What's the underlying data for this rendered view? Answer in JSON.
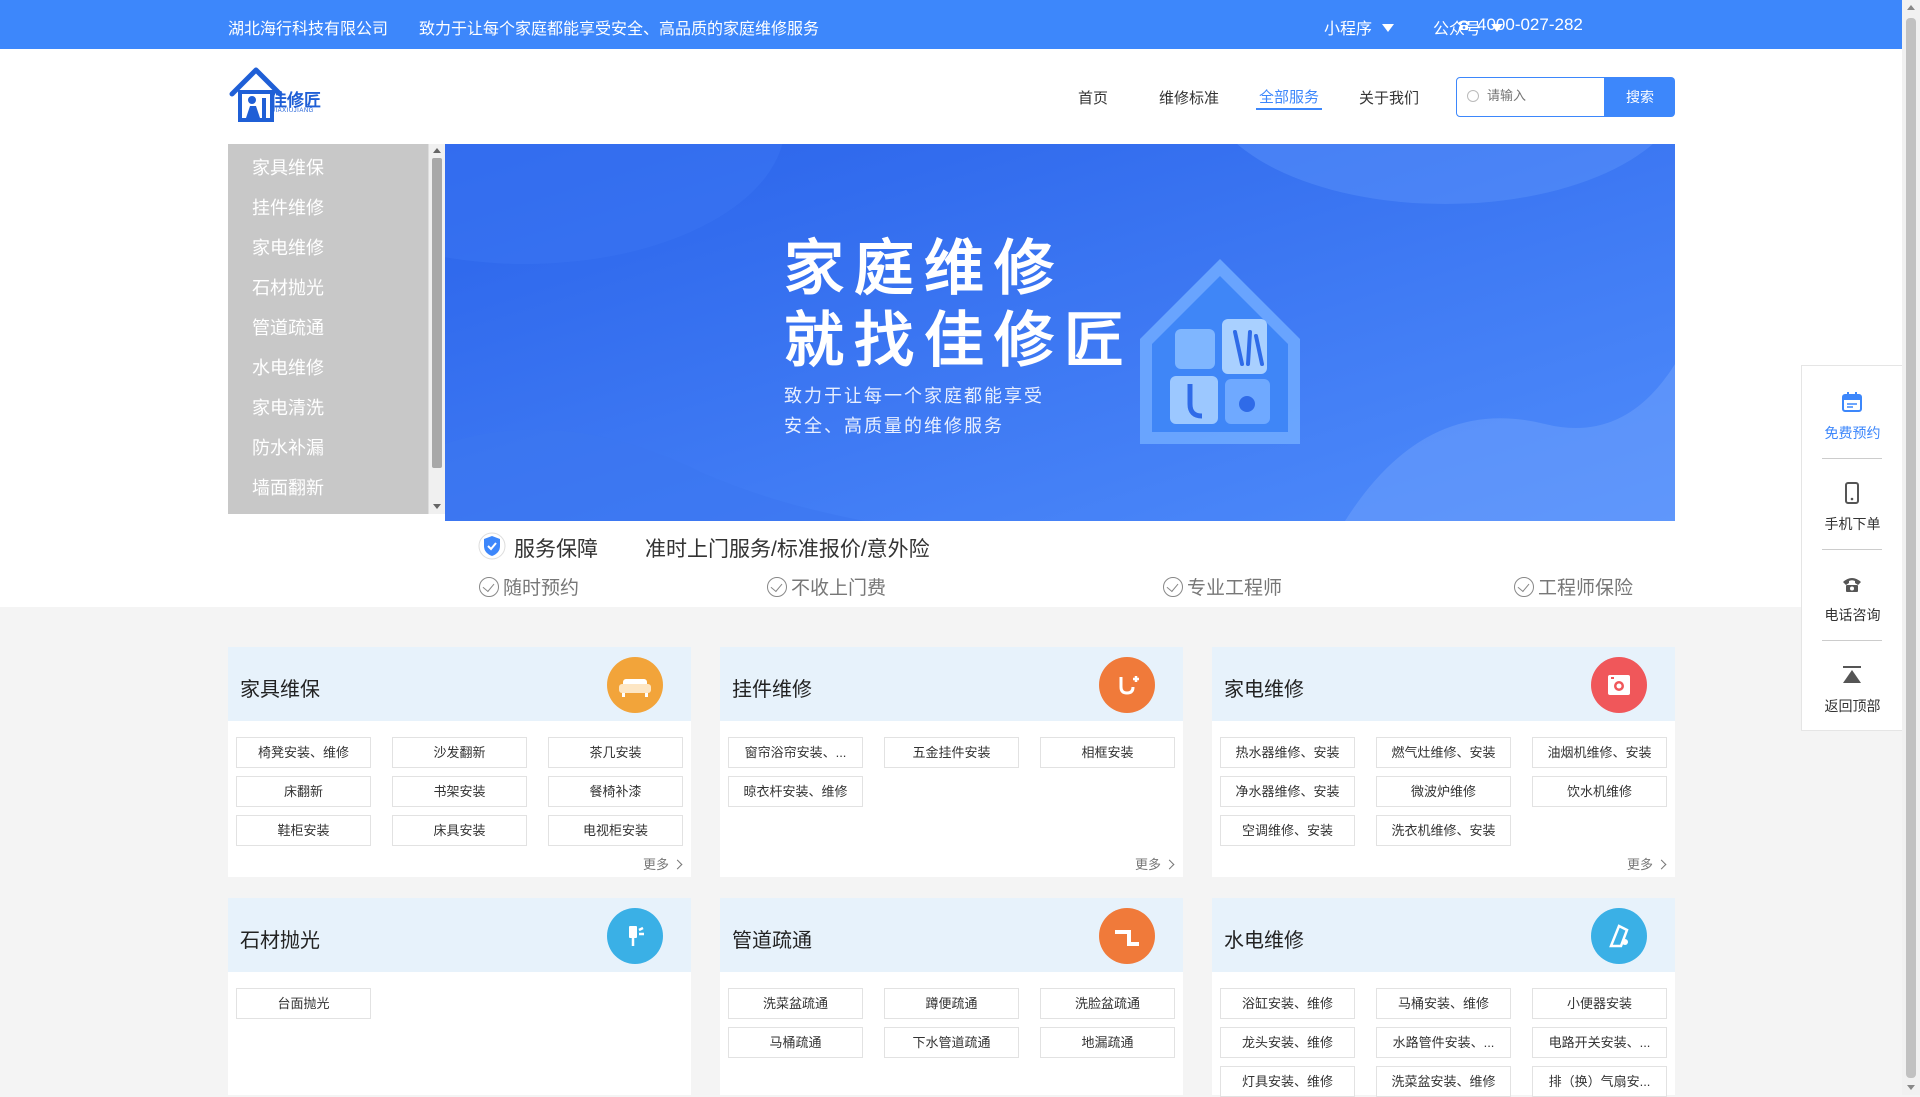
{
  "topbar": {
    "company": "湖北海行科技有限公司",
    "slogan": "致力于让每个家庭都能享受安全、高品质的家庭维修服务",
    "miniprogram": "小程序",
    "official_account": "公众号",
    "phone": "4000-027-282"
  },
  "header": {
    "logo_text": "佳修匠",
    "logo_sub": "JIAXIUJIANG",
    "nav": [
      "首页",
      "维修标准",
      "全部服务",
      "关于我们"
    ],
    "active_nav": "全部服务",
    "search_placeholder": "请输入",
    "search_button": "搜索"
  },
  "category_menu": [
    "家具维保",
    "挂件维修",
    "家电维修",
    "石材抛光",
    "管道疏通",
    "水电维修",
    "家电清洗",
    "防水补漏",
    "墙面翻新"
  ],
  "banner": {
    "title_line1": "家庭维修",
    "title_line2": "就找佳修匠",
    "subtitle_line1": "致力于让每一个家庭都能享受",
    "subtitle_line2": "安全、高质量的维修服务"
  },
  "guarantee": {
    "title": "服务保障",
    "desc": "准时上门服务/标准报价/意外险",
    "features": [
      "随时预约",
      "不收上门费",
      "专业工程师",
      "工程师保险"
    ]
  },
  "cards": [
    {
      "name": "家具维保",
      "icon": "sofa-icon",
      "color": "#f2a43a",
      "tags": [
        "椅凳安装、维修",
        "沙发翻新",
        "茶几安装",
        "床翻新",
        "书架安装",
        "餐椅补漆",
        "鞋柜安装",
        "床具安装",
        "电视柜安装"
      ],
      "more": "更多"
    },
    {
      "name": "挂件维修",
      "icon": "hook-icon",
      "color": "#f07a3a",
      "tags": [
        "窗帘浴帘安装、...",
        "五金挂件安装",
        "相框安装",
        "晾衣杆安装、维修"
      ],
      "more": "更多"
    },
    {
      "name": "家电维修",
      "icon": "appliance-icon",
      "color": "#f0575a",
      "tags": [
        "热水器维修、安装",
        "燃气灶维修、安装",
        "油烟机维修、安装",
        "净水器维修、安装",
        "微波炉维修",
        "饮水机维修",
        "空调维修、安装",
        "洗衣机维修、安装"
      ],
      "more": "更多"
    },
    {
      "name": "石材抛光",
      "icon": "polish-icon",
      "color": "#3ab0e6",
      "tags": [
        "台面抛光"
      ]
    },
    {
      "name": "管道疏通",
      "icon": "pipe-icon",
      "color": "#f07a3a",
      "tags": [
        "洗菜盆疏通",
        "蹲便疏通",
        "洗脸盆疏通",
        "马桶疏通",
        "下水管道疏通",
        "地漏疏通"
      ]
    },
    {
      "name": "水电维修",
      "icon": "electric-icon",
      "color": "#3ab0e6",
      "tags": [
        "浴缸安装、维修",
        "马桶安装、维修",
        "小便器安装",
        "龙头安装、维修",
        "水路管件安装、...",
        "电路开关安装、...",
        "灯具安装、维修",
        "洗菜盆安装、维修",
        "排（换）气扇安..."
      ]
    }
  ],
  "float_panel": [
    "免费预约",
    "手机下单",
    "电话咨询",
    "返回顶部"
  ]
}
